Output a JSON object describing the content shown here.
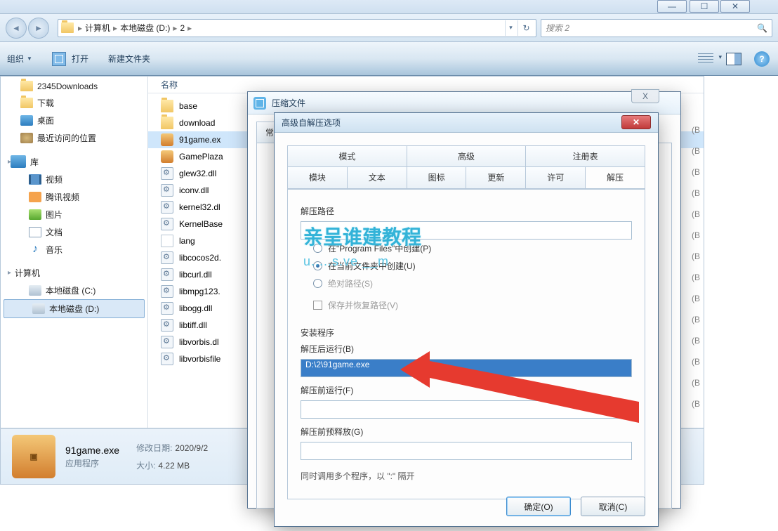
{
  "window_buttons": {
    "min": "—",
    "max": "☐",
    "close": "✕"
  },
  "breadcrumbs": [
    "计算机",
    "本地磁盘 (D:)",
    "2"
  ],
  "search_placeholder": "搜索 2",
  "toolbar": {
    "organize": "组织",
    "open": "打开",
    "new_folder": "新建文件夹"
  },
  "sidebar": {
    "nodes": [
      {
        "icon": "folder",
        "label": "2345Downloads"
      },
      {
        "icon": "folder",
        "label": "下载"
      },
      {
        "icon": "desktop",
        "label": "桌面"
      },
      {
        "icon": "blueball",
        "label": "最近访问的位置"
      }
    ],
    "library_hdr": "库",
    "libs": [
      {
        "icon": "video",
        "label": "视频"
      },
      {
        "icon": "tencent",
        "label": "腾讯视频"
      },
      {
        "icon": "pic",
        "label": "图片"
      },
      {
        "icon": "doc",
        "label": "文档"
      },
      {
        "icon": "music",
        "label": "音乐"
      }
    ],
    "computer_hdr": "计算机",
    "drives": [
      {
        "icon": "drive",
        "label": "本地磁盘 (C:)"
      },
      {
        "icon": "drive",
        "label": "本地磁盘 (D:)",
        "selected": true
      }
    ]
  },
  "col_name": "名称",
  "files": [
    {
      "icon": "folder",
      "name": "base"
    },
    {
      "icon": "folder",
      "name": "download"
    },
    {
      "icon": "exe",
      "name": "91game.ex",
      "selected": true
    },
    {
      "icon": "exe",
      "name": "GamePlaza"
    },
    {
      "icon": "dll",
      "name": "glew32.dll"
    },
    {
      "icon": "dll",
      "name": "iconv.dll"
    },
    {
      "icon": "dll",
      "name": "kernel32.dl"
    },
    {
      "icon": "dll",
      "name": "KernelBase"
    },
    {
      "icon": "blank",
      "name": "lang"
    },
    {
      "icon": "dll",
      "name": "libcocos2d."
    },
    {
      "icon": "dll",
      "name": "libcurl.dll"
    },
    {
      "icon": "dll",
      "name": "libmpg123."
    },
    {
      "icon": "dll",
      "name": "libogg.dll"
    },
    {
      "icon": "dll",
      "name": "libtiff.dll"
    },
    {
      "icon": "dll",
      "name": "libvorbis.dl"
    },
    {
      "icon": "dll",
      "name": "libvorbisfile"
    }
  ],
  "kb_marks": [
    "(B",
    "(B",
    "(B",
    "(B",
    "(B",
    "(B",
    "(B",
    "(B",
    "(B",
    "(B",
    "(B",
    "(B",
    "(B",
    "(B"
  ],
  "details": {
    "filename": "91game.exe",
    "filetype": "应用程序",
    "mod_label": "修改日期:",
    "mod_value": "2020/9/2",
    "size_label": "大小:",
    "size_value": "4.22 MB"
  },
  "dlg1": {
    "title": "压缩文件",
    "close": "X",
    "tabs": [
      "常"
    ]
  },
  "dlg2": {
    "title": "高级自解压选项",
    "close": "✕",
    "tabs_top": [
      "模式",
      "高级",
      "注册表"
    ],
    "tabs_bottom": [
      "模块",
      "文本",
      "图标",
      "更新",
      "许可",
      "解压"
    ],
    "active_tab": "解压",
    "extract_path_label": "解压路径",
    "extract_path_value": "",
    "radios": [
      {
        "label": "在\"Program Files\"中创建(P)",
        "checked": false
      },
      {
        "label": "在当前文件夹中创建(U)",
        "checked": true
      },
      {
        "label": "绝对路径(S)",
        "disabled": true
      }
    ],
    "save_restore": "保存并恢复路径(V)",
    "installer_label": "安装程序",
    "run_after_label": "解压后运行(B)",
    "run_after_value": "D:\\2\\91game.exe",
    "run_before_label": "解压前运行(F)",
    "run_before_value": "",
    "pre_release_label": "解压前预释放(G)",
    "pre_release_value": "",
    "multi_hint": "同时调用多个程序，以 \":\" 隔开",
    "ok": "确定(O)",
    "cancel": "取消(C)"
  },
  "watermark": "亲呈谁建教程",
  "wm2": "u.....s.ve.__m"
}
